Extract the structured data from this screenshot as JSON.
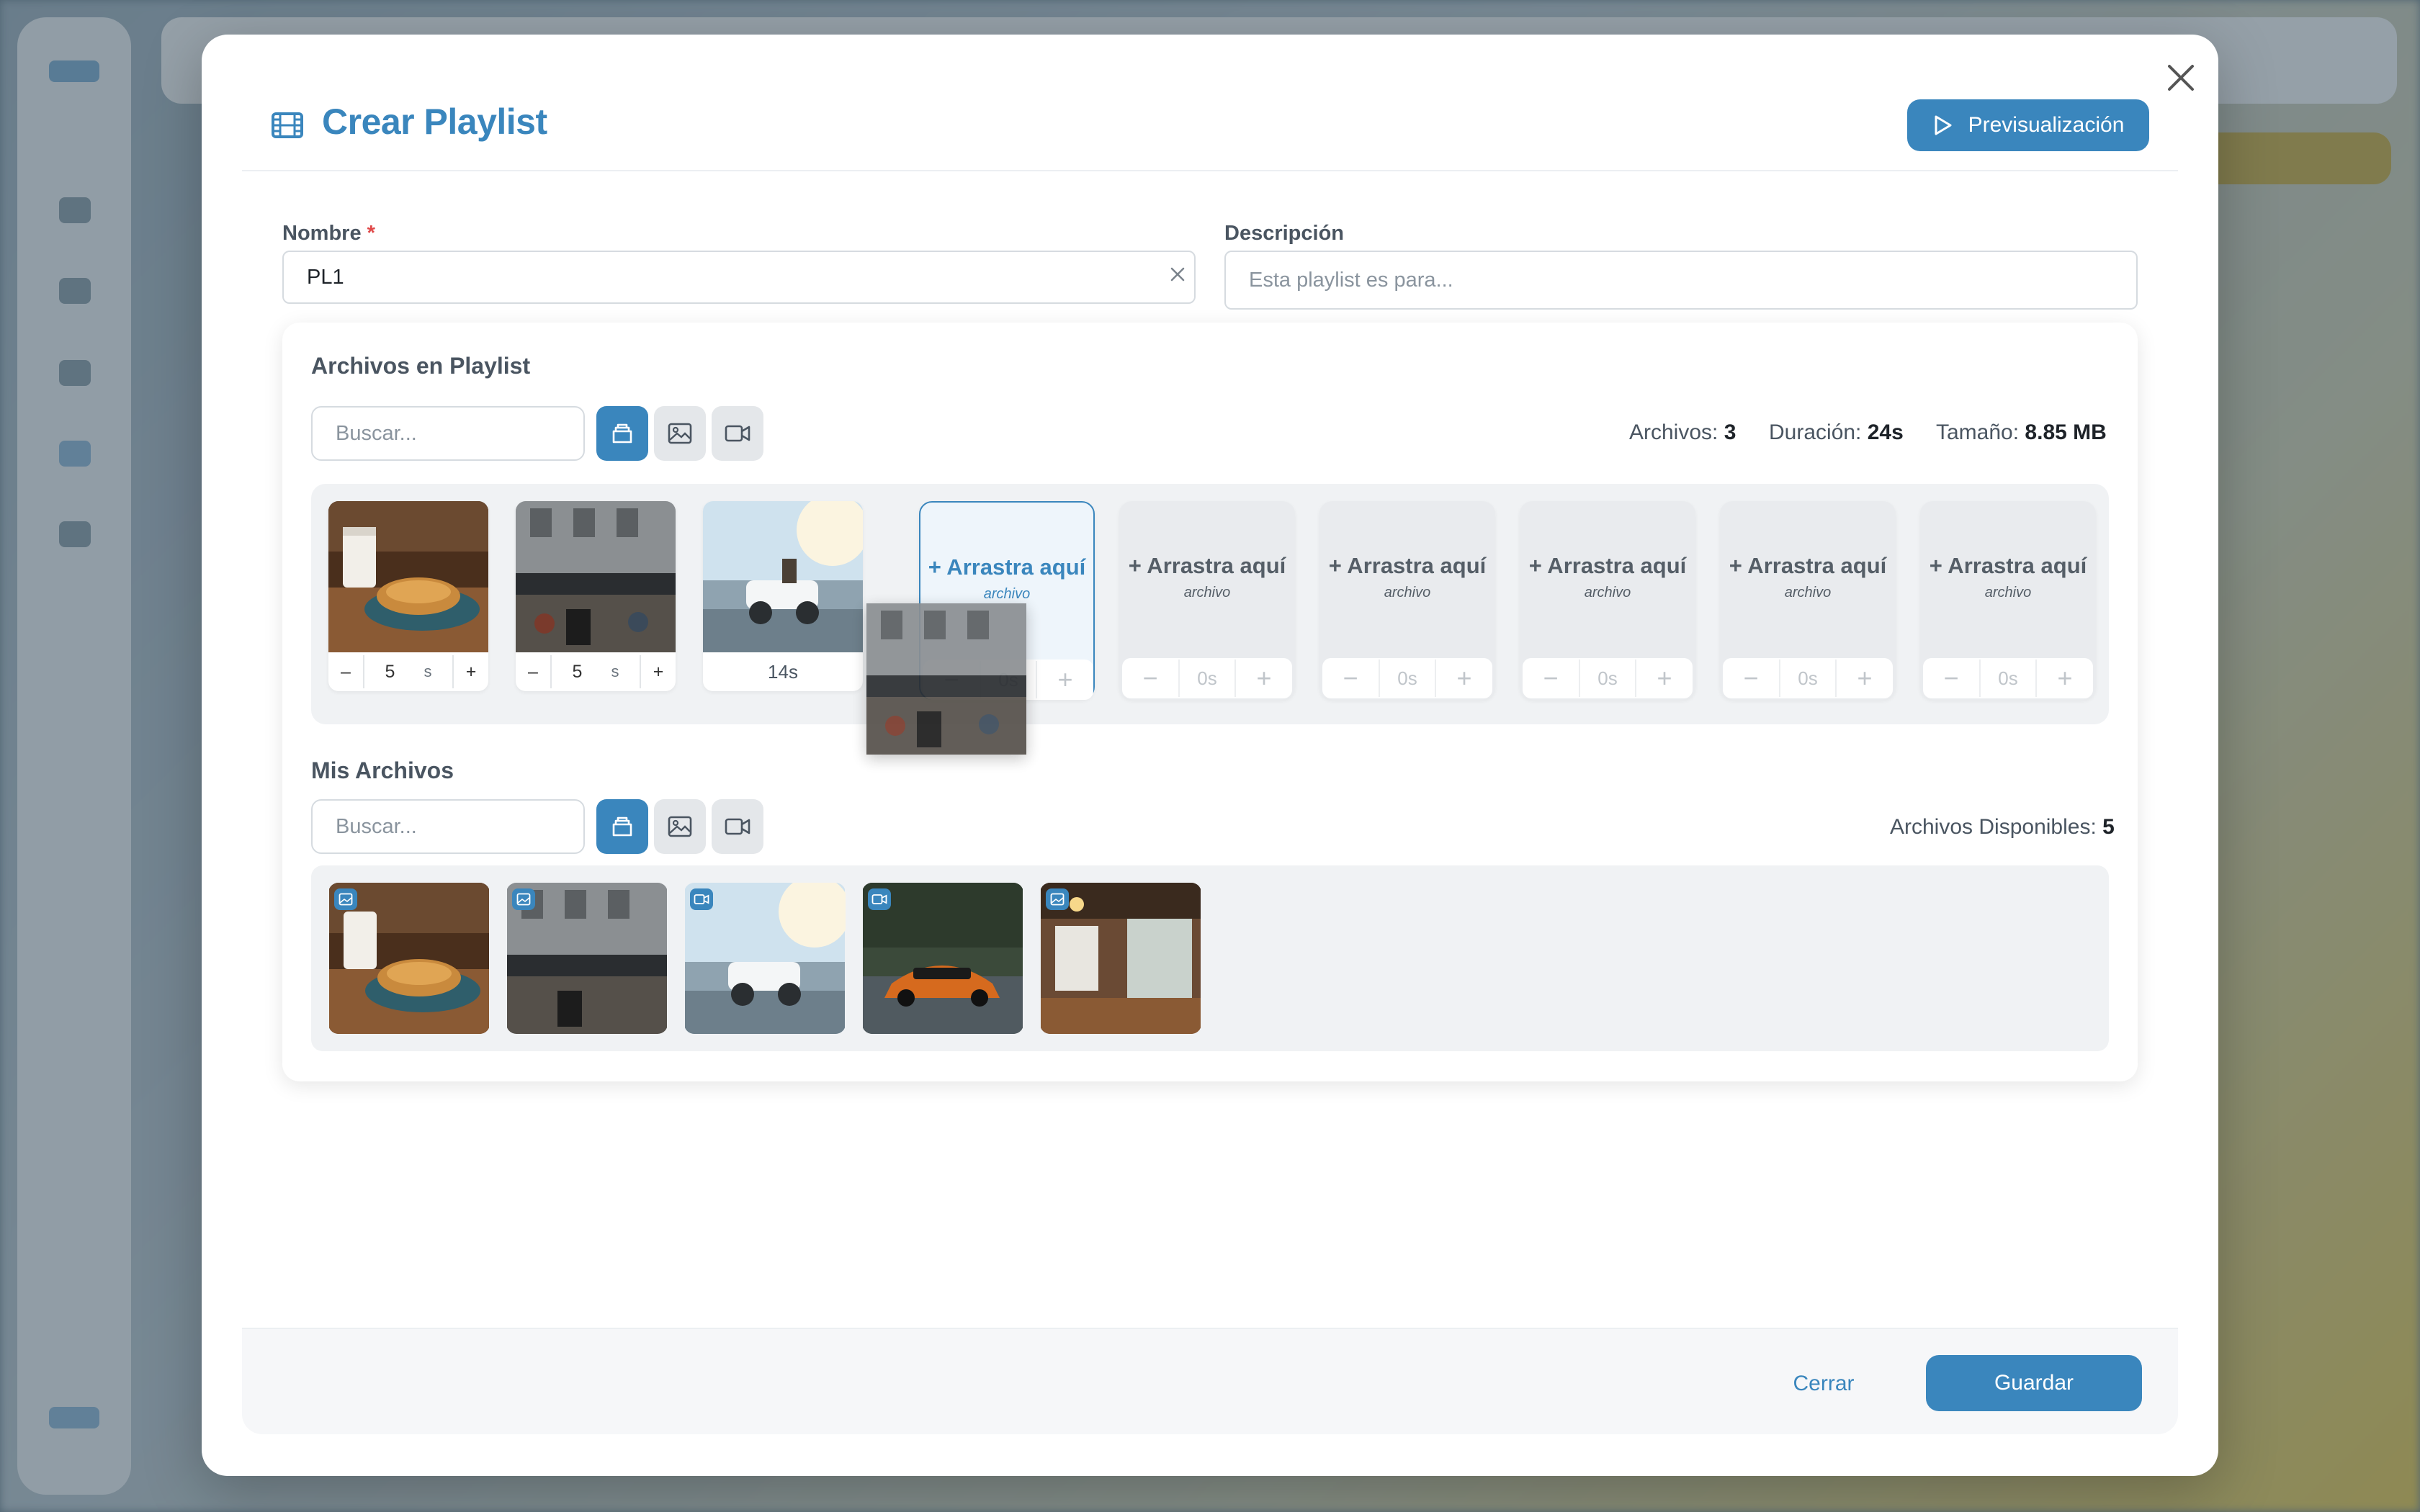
{
  "modal": {
    "title": "Crear Playlist",
    "title_icon": "film-icon",
    "preview_label": "Previsualización",
    "close_icon": "close-icon"
  },
  "form": {
    "name_label": "Nombre",
    "name_required": "*",
    "name_value": "PL1",
    "description_label": "Descripción",
    "description_placeholder": "Esta playlist es para..."
  },
  "playlist": {
    "title": "Archivos en Playlist",
    "search_placeholder": "Buscar...",
    "filters": [
      "all-files-icon",
      "image-icon",
      "video-icon"
    ],
    "stats": {
      "files_label": "Archivos:",
      "files_value": "3",
      "duration_label": "Duración:",
      "duration_value": "24s",
      "size_label": "Tamaño:",
      "size_value": "8.85 MB"
    },
    "items": [
      {
        "type": "image",
        "thumb": "croissant-coffee",
        "duration": "5",
        "unit": "s",
        "minus": "–",
        "plus": "+"
      },
      {
        "type": "image",
        "thumb": "street-cafe",
        "duration": "5",
        "unit": "s",
        "minus": "–",
        "plus": "+"
      },
      {
        "type": "video",
        "thumb": "beach-buggy",
        "duration": "14s"
      }
    ],
    "empty_slots": [
      {
        "label": "+ Arrastra aquí",
        "sub": "archivo",
        "value": "0s",
        "active": true
      },
      {
        "label": "+ Arrastra aquí",
        "sub": "archivo",
        "value": "0s"
      },
      {
        "label": "+ Arrastra aquí",
        "sub": "archivo",
        "value": "0s"
      },
      {
        "label": "+ Arrastra aquí",
        "sub": "archivo",
        "value": "0s"
      },
      {
        "label": "+ Arrastra aquí",
        "sub": "archivo",
        "value": "0s"
      },
      {
        "label": "+ Arrastra aquí",
        "sub": "archivo",
        "value": "0s"
      }
    ]
  },
  "library": {
    "title": "Mis Archivos",
    "search_placeholder": "Buscar...",
    "available_label": "Archivos Disponibles:",
    "available_value": "5",
    "items": [
      {
        "type": "image",
        "badge": "image-icon",
        "thumb": "croissant-coffee"
      },
      {
        "type": "image",
        "badge": "image-icon",
        "thumb": "street-cafe"
      },
      {
        "type": "video",
        "badge": "video-icon",
        "thumb": "beach-buggy"
      },
      {
        "type": "video",
        "badge": "video-icon",
        "thumb": "orange-sports-car"
      },
      {
        "type": "image",
        "badge": "image-icon",
        "thumb": "cafe-interior"
      }
    ]
  },
  "footer": {
    "close_label": "Cerrar",
    "save_label": "Guardar"
  },
  "colors": {
    "accent": "#3a86bd",
    "required": "#e04848",
    "muted_bg": "#f0f2f4"
  }
}
